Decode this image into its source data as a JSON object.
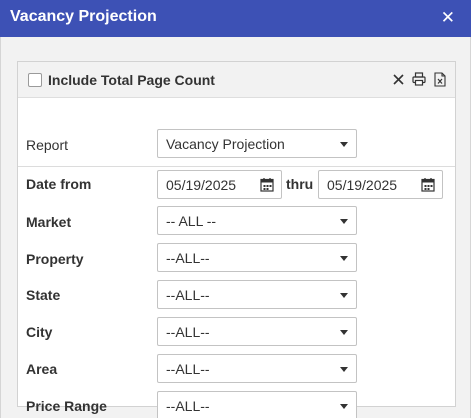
{
  "dialog": {
    "title": "Vacancy Projection"
  },
  "options": {
    "include_page_count_label": "Include Total Page Count",
    "include_page_count_checked": false
  },
  "toolbar": {
    "icons": [
      "clear-icon",
      "print-icon",
      "excel-export-icon"
    ]
  },
  "report": {
    "label": "Report",
    "value": "Vacancy Projection"
  },
  "date_range": {
    "label": "Date from",
    "from": "05/19/2025",
    "thru_label": "thru",
    "to": "05/19/2025"
  },
  "filters": {
    "market": {
      "label": "Market",
      "value": "-- ALL --"
    },
    "property": {
      "label": "Property",
      "value": "--ALL--"
    },
    "state": {
      "label": "State",
      "value": "--ALL--"
    },
    "city": {
      "label": "City",
      "value": "--ALL--"
    },
    "area": {
      "label": "Area",
      "value": "--ALL--"
    },
    "price_range": {
      "label": "Price Range",
      "value": "--ALL--"
    }
  }
}
